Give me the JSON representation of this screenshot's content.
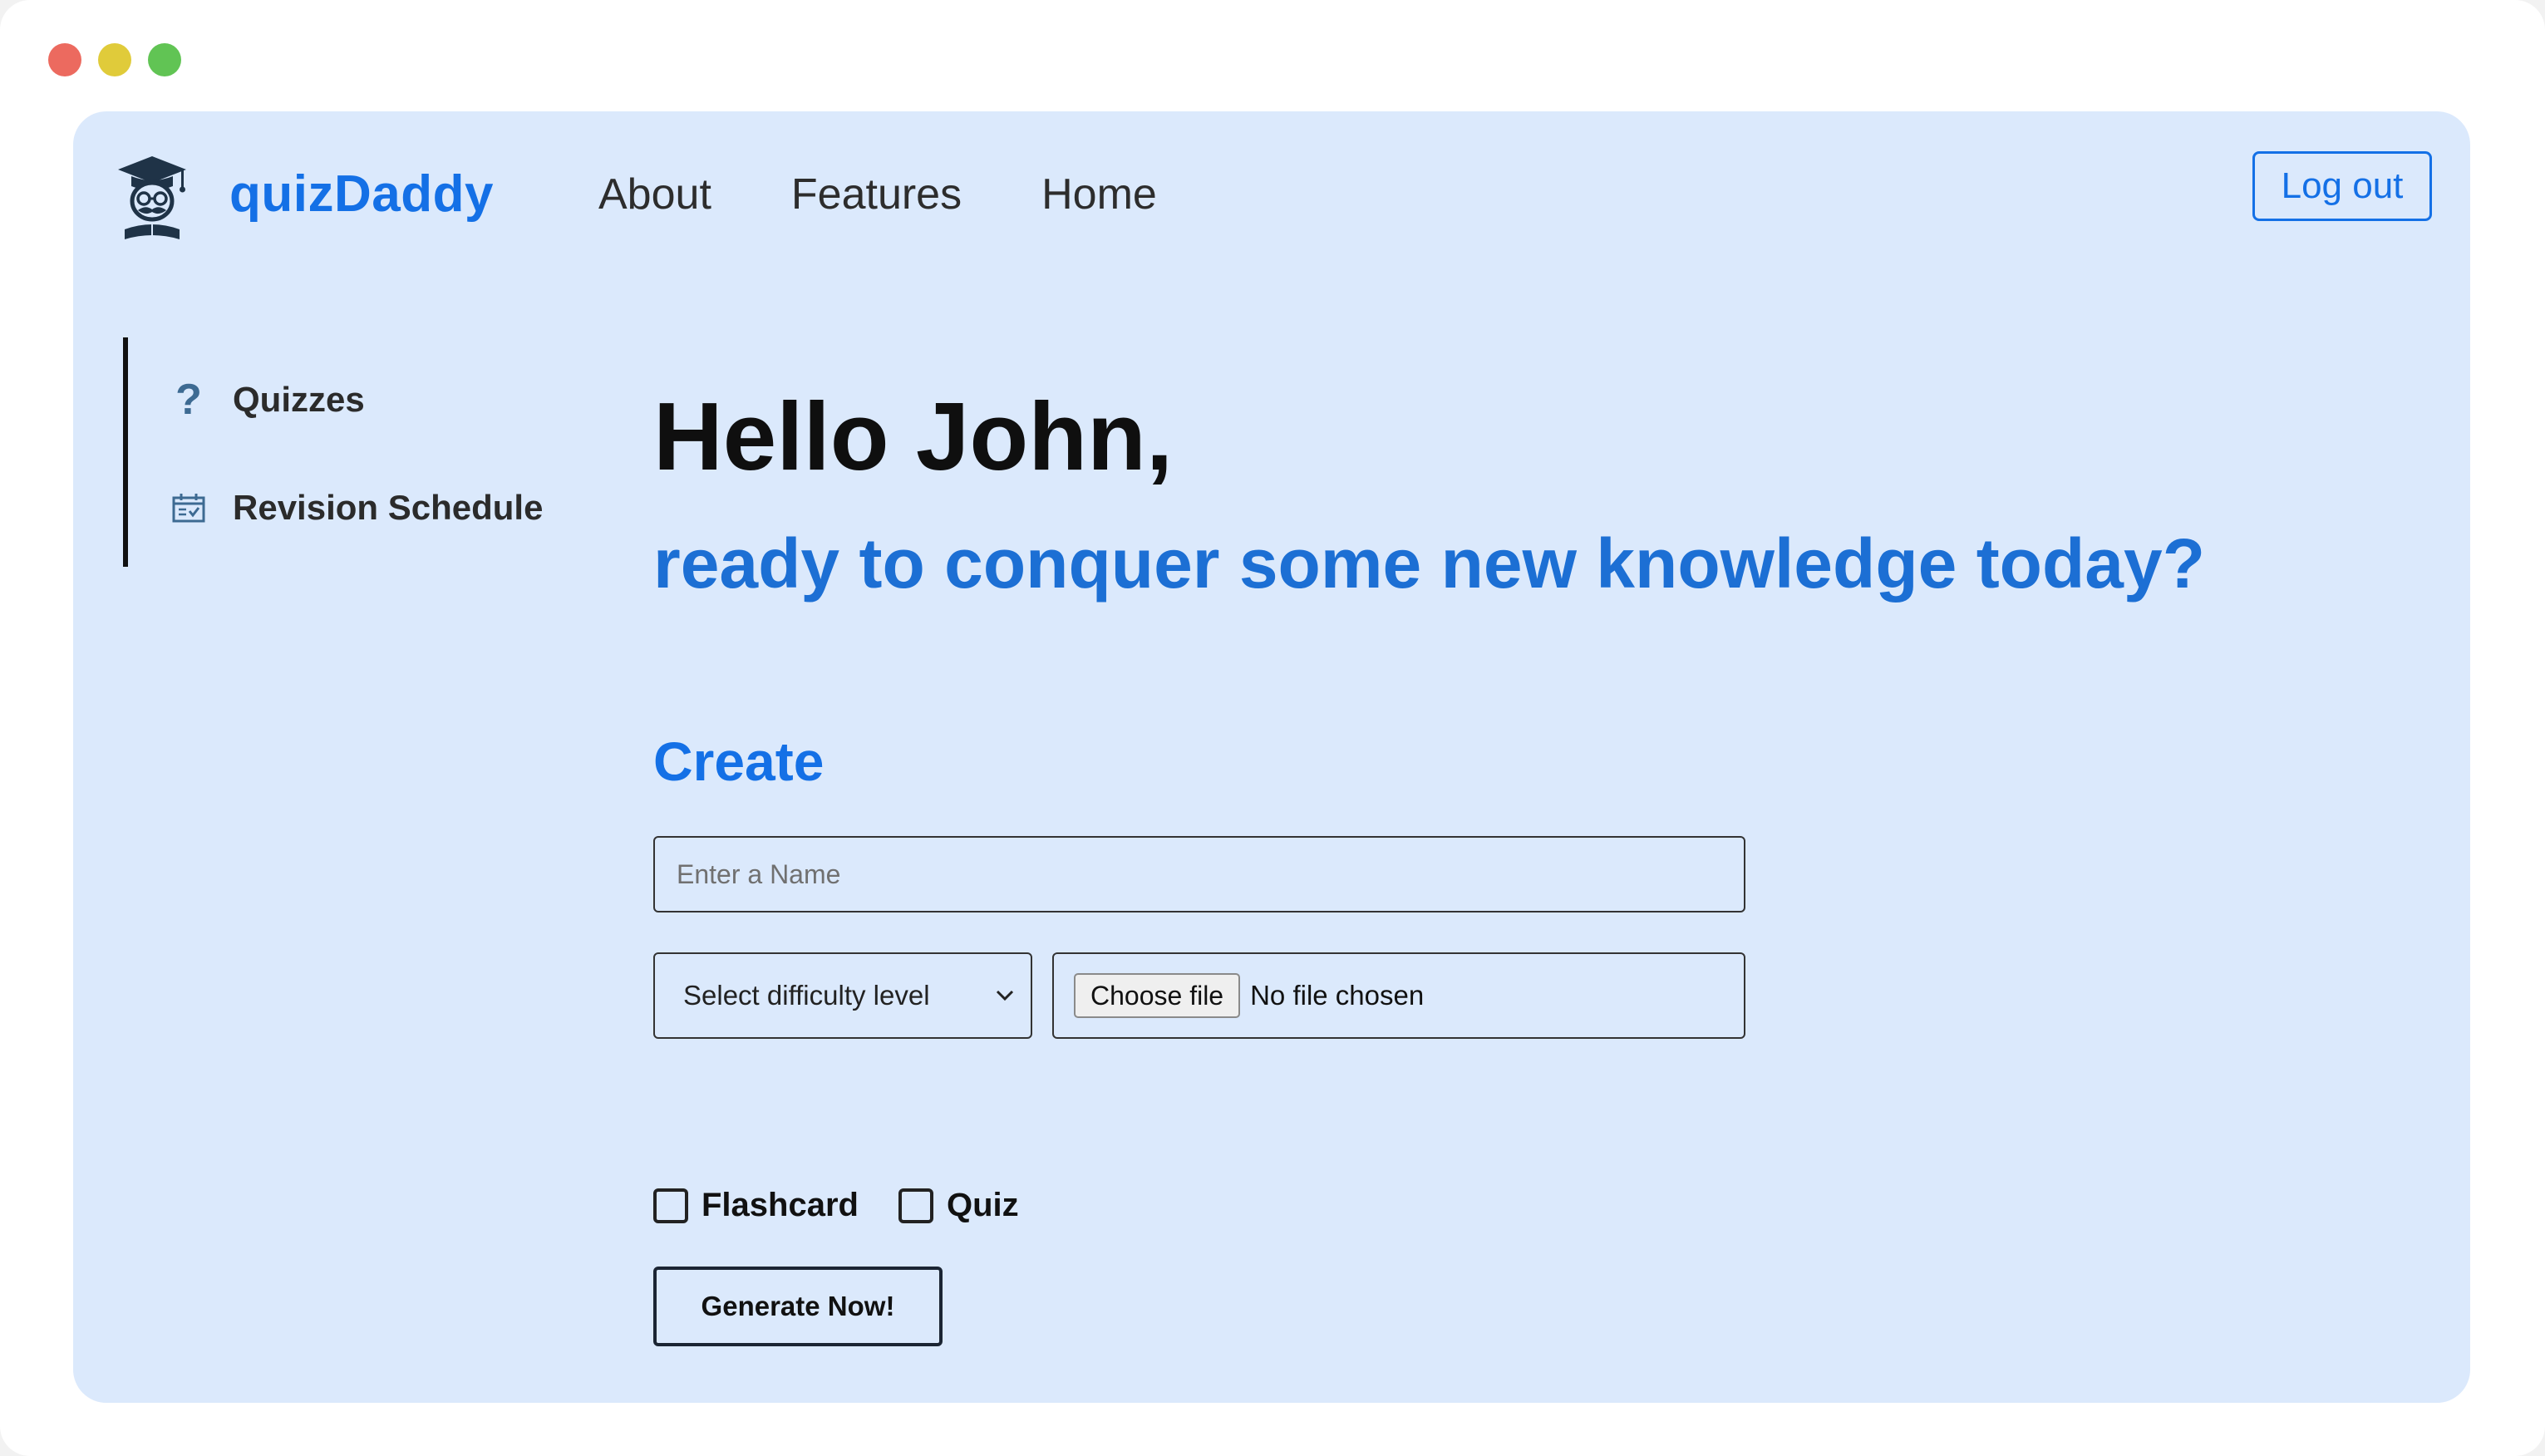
{
  "header": {
    "brand": "quizDaddy",
    "nav": [
      "About",
      "Features",
      "Home"
    ],
    "logout_label": "Log out",
    "logo_icon": "graduate-mustache-logo"
  },
  "sidebar": {
    "items": [
      {
        "label": "Quizzes",
        "icon": "question-mark-icon"
      },
      {
        "label": "Revision Schedule",
        "icon": "calendar-check-icon"
      }
    ]
  },
  "main": {
    "greeting": "Hello John,",
    "subtitle": "ready to conquer some new knowledge today?",
    "create_heading": "Create",
    "name_placeholder": "Enter a Name",
    "difficulty_selected": "Select difficulty level",
    "file_button": "Choose file",
    "file_status": "No file chosen",
    "checkboxes": [
      {
        "label": "Flashcard",
        "checked": false
      },
      {
        "label": "Quiz",
        "checked": false
      }
    ],
    "generate_label": "Generate Now!"
  },
  "colors": {
    "accent": "#1470e6",
    "app_background": "#dbe9fc",
    "sidebar_icon": "#3d6a92"
  }
}
